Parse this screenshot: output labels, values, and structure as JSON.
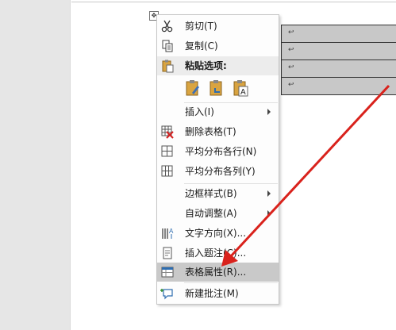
{
  "menu": {
    "cut": "剪切(T)",
    "copy": "复制(C)",
    "paste_options": "粘贴选项:",
    "insert": "插入(I)",
    "delete_table": "删除表格(T)",
    "distribute_rows": "平均分布各行(N)",
    "distribute_cols": "平均分布各列(Y)",
    "border_styles": "边框样式(B)",
    "autofit": "自动调整(A)",
    "text_direction": "文字方向(X)...",
    "insert_caption": "插入题注(C)...",
    "table_properties": "表格属性(R)...",
    "new_comment": "新建批注(M)"
  },
  "table": {
    "cell_mark": "↩"
  },
  "colors": {
    "highlight": "#c9c9c9",
    "annotation_arrow": "#d9221c"
  },
  "icons": [
    "scissors-icon",
    "copy-icon",
    "paste-icon",
    "paste-keep-format-icon",
    "paste-merge-icon",
    "paste-text-only-icon",
    "delete-table-icon",
    "distribute-rows-icon",
    "distribute-cols-icon",
    "text-direction-icon",
    "insert-caption-icon",
    "table-properties-icon",
    "new-comment-icon",
    "table-move-handle-icon"
  ]
}
